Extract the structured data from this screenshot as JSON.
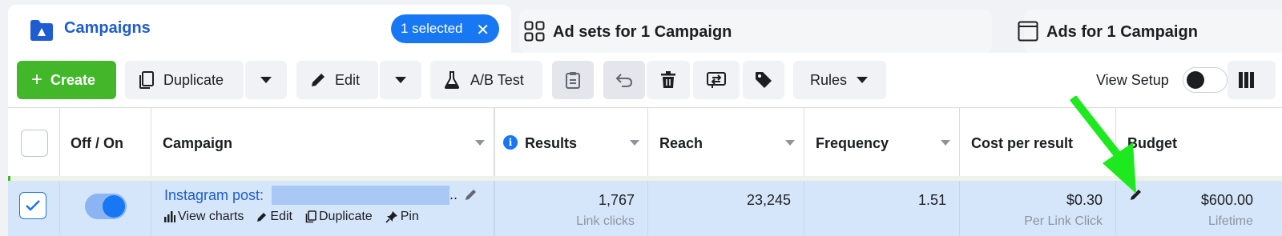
{
  "tabs": {
    "campaigns": {
      "label": "Campaigns",
      "selected_label": "1 selected"
    },
    "adsets": {
      "label": "Ad sets for 1 Campaign"
    },
    "ads": {
      "label": "Ads for 1 Campaign"
    }
  },
  "toolbar": {
    "create_label": "Create",
    "duplicate_label": "Duplicate",
    "edit_label": "Edit",
    "abtest_label": "A/B Test",
    "rules_label": "Rules",
    "view_setup_label": "View Setup",
    "view_setup_on": false
  },
  "table": {
    "headers": {
      "onoff": "Off / On",
      "campaign": "Campaign",
      "results": "Results",
      "reach": "Reach",
      "frequency": "Frequency",
      "cost_per_result": "Cost per result",
      "budget": "Budget"
    },
    "row": {
      "selected": true,
      "active": true,
      "campaign_name": "Instagram post:",
      "campaign_ellipsis": "..",
      "actions": {
        "view_charts": "View charts",
        "edit": "Edit",
        "duplicate": "Duplicate",
        "pin": "Pin"
      },
      "results": "1,767",
      "results_sub": "Link clicks",
      "reach": "23,245",
      "frequency": "1.51",
      "cost_per_result": "$0.30",
      "cost_per_result_sub": "Per Link Click",
      "budget": "$600.00",
      "budget_sub": "Lifetime"
    }
  },
  "colors": {
    "accent": "#1877f2",
    "create": "#42b72a",
    "row_selected": "#d5e6fb",
    "annotation_arrow": "#1ee81e"
  }
}
